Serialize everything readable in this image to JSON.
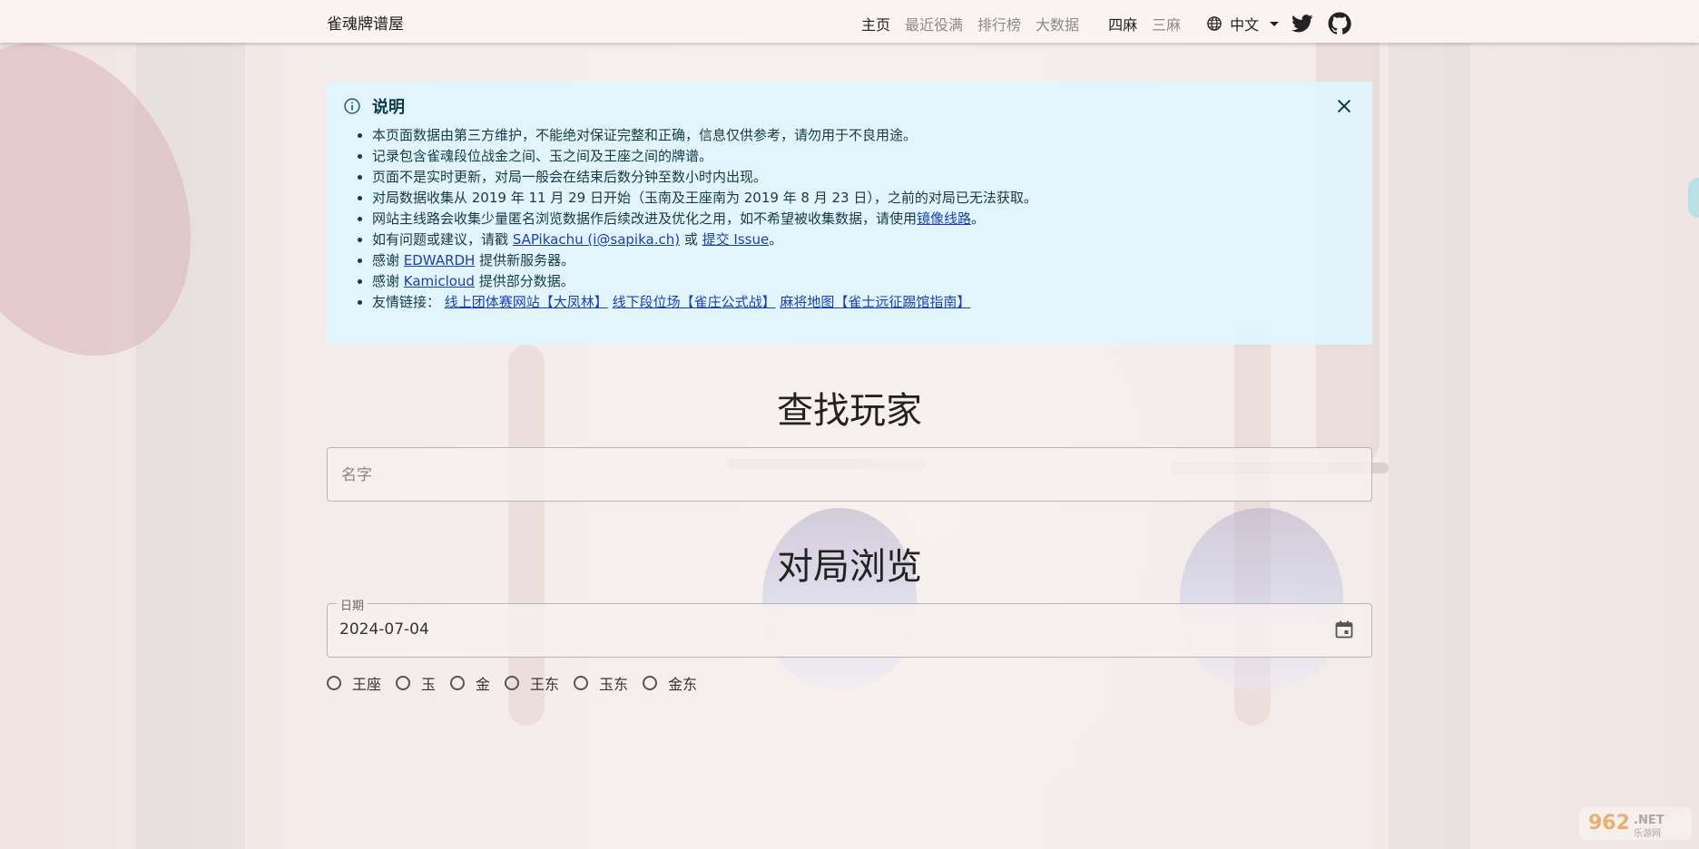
{
  "brand": "雀魂牌谱屋",
  "nav": {
    "links": [
      "主页",
      "最近役满",
      "排行榜",
      "大数据"
    ],
    "modes": [
      "四麻",
      "三麻"
    ],
    "language": "中文"
  },
  "icons": {
    "language": "globe-icon",
    "twitter": "twitter-icon",
    "github": "github-icon",
    "info": "info-icon",
    "close": "close-icon",
    "calendar": "calendar-icon"
  },
  "notice": {
    "title": "说明",
    "items": [
      "本页面数据由第三方维护，不能绝对保证完整和正确，信息仅供参考，请勿用于不良用途。",
      "记录包含雀魂段位战金之间、玉之间及王座之间的牌谱。",
      "页面不是实时更新，对局一般会在结束后数分钟至数小时内出现。",
      "对局数据收集从 2019 年 11 月 29 日开始（玉南及王座南为 2019 年 8 月 23 日），之前的对局已无法获取。"
    ],
    "tracking": {
      "text": "网站主线路会收集少量匿名浏览数据作后续改进及优化之用，如不希望被收集数据，请使用",
      "link": "镜像线路",
      "end": "。"
    },
    "contact": {
      "prefix": "如有问题或建议，请戳 ",
      "link1": "SAPikachu (i@sapika.ch)",
      "mid": " 或 ",
      "link2": "提交 Issue",
      "end": "。"
    },
    "thanks1": {
      "prefix": "感谢 ",
      "link": "EDWARDH",
      "suffix": " 提供新服务器。"
    },
    "thanks2": {
      "prefix": "感谢 ",
      "link": "Kamicloud",
      "suffix": " 提供部分数据。"
    },
    "friends": {
      "prefix": "友情链接：",
      "links": [
        "线上团体赛网站【大凤林】",
        "线下段位场【雀庄公式战】",
        "麻将地图【雀士远征踢馆指南】"
      ]
    }
  },
  "search": {
    "heading": "查找玩家",
    "placeholder": "名字"
  },
  "browse": {
    "heading": "对局浏览",
    "date_label": "日期",
    "date_value": "2024-07-04",
    "rooms": [
      "王座",
      "玉",
      "金",
      "王东",
      "玉东",
      "金东"
    ]
  },
  "colors": {
    "notice_bg": "#e1f5fc",
    "link": "#1a3fb5",
    "topbar_bg": "#faf3f1"
  }
}
